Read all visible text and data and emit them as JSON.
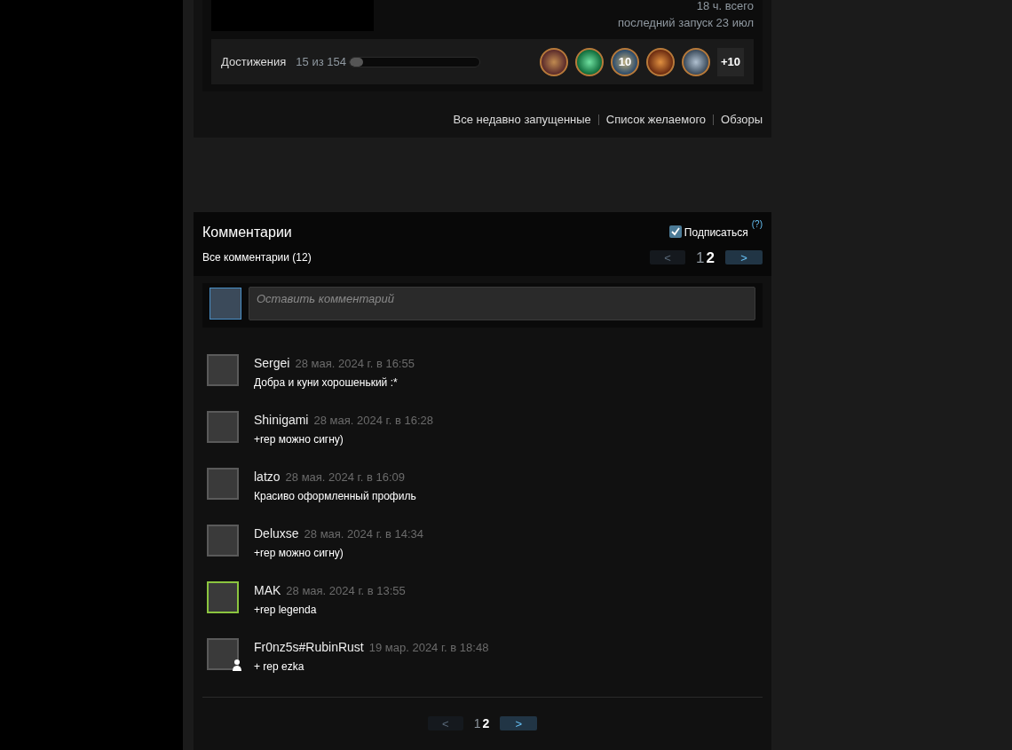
{
  "game": {
    "hours": "18 ч. всего",
    "last_played": "последний запуск 23 июл"
  },
  "achievements": {
    "label": "Достижения",
    "count": "15 из 154",
    "level": 0.1,
    "icons": [
      {
        "kind": "portrait"
      },
      {
        "kind": "skull"
      },
      {
        "kind": "number",
        "label": "10"
      },
      {
        "kind": "fire"
      },
      {
        "kind": "blade"
      }
    ],
    "more": "+10"
  },
  "links": [
    "Все недавно запущенные",
    "Список желаемого",
    "Обзоры"
  ],
  "comments_panel": {
    "title": "Комментарии",
    "subscribe": {
      "label": "Подписаться",
      "checked": true,
      "help": "(?)"
    },
    "all_label": "Все комментарии (12)",
    "pager": {
      "prev": "<",
      "next": ">",
      "prev_disabled": true,
      "next_disabled": false,
      "pages": [
        {
          "label": "1",
          "selected": false
        },
        {
          "label": "2",
          "selected": true
        }
      ]
    },
    "input": {
      "placeholder": "Оставить комментарий"
    },
    "comments": [
      {
        "author": "Sergei",
        "time": "28 мая. 2024 г. в 16:55",
        "text": "Добра и куни хорошенький :*",
        "color": "#5a5a5a"
      },
      {
        "author": "Shinigami",
        "time": "28 мая. 2024 г. в 16:28",
        "text": "+rep можно сигну)",
        "color": "#5a5a5a"
      },
      {
        "author": "latzo",
        "time": "28 мая. 2024 г. в 16:09",
        "text": "Красиво оформленный профиль",
        "color": "#5a5a5a"
      },
      {
        "author": "Deluxse",
        "time": "28 мая. 2024 г. в 14:34",
        "text": "+rep можно сигну)",
        "color": "#5a5a5a"
      },
      {
        "author": "MAK",
        "time": "28 мая. 2024 г. в 13:55",
        "text": "+rep legenda",
        "color": "#8bc53f"
      },
      {
        "author": "Fr0nz5s#RubinRust",
        "time": "19 мар. 2024 г. в 18:48",
        "text": "+ rep ezka",
        "color": "#5a5a5a",
        "friend_badge": true
      }
    ],
    "bottom_pager": {
      "prev": "<",
      "next": ">",
      "prev_disabled": true,
      "next_disabled": false,
      "pages": [
        {
          "label": "1",
          "selected": false
        },
        {
          "label": "2",
          "selected": true
        }
      ]
    }
  }
}
